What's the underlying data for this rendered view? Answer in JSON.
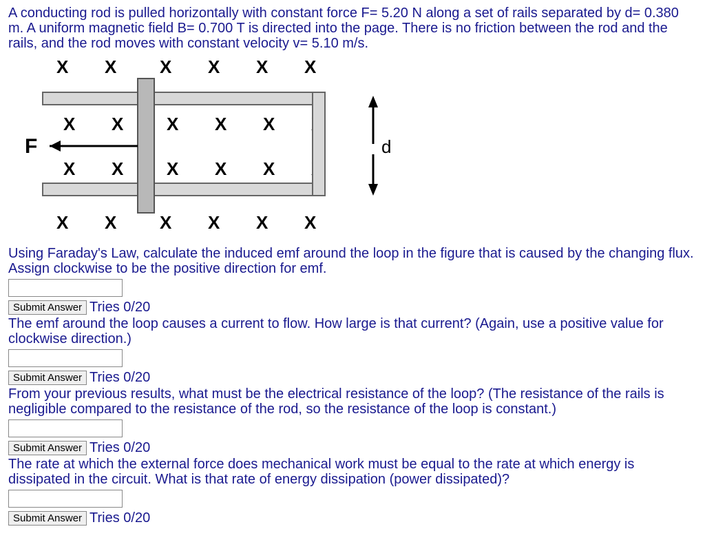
{
  "problem_intro": "A conducting rod is pulled horizontally with constant force F= 5.20 N along a set of rails separated by d= 0.380 m. A uniform magnetic field B= 0.700 T is directed into the page. There is no friction between the rod and the rails, and the rod moves with constant velocity v= 5.10 m/s.",
  "diagram": {
    "F_label": "F",
    "d_label": "d"
  },
  "questions": [
    {
      "text": "Using Faraday's Law, calculate the induced emf around the loop in the figure that is caused by the changing flux. Assign clockwise to be the positive direction for emf.",
      "submit_label": "Submit Answer",
      "tries": "Tries 0/20"
    },
    {
      "text": "The emf around the loop causes a current to flow. How large is that current? (Again, use a positive value for clockwise direction.)",
      "submit_label": "Submit Answer",
      "tries": "Tries 0/20"
    },
    {
      "text": "From your previous results, what must be the electrical resistance of the loop? (The resistance of the rails is negligible compared to the resistance of the rod, so the resistance of the loop is constant.)",
      "submit_label": "Submit Answer",
      "tries": "Tries 0/20"
    },
    {
      "text": "The rate at which the external force does mechanical work must be equal to the rate at which energy is dissipated in the circuit. What is that rate of energy dissipation (power dissipated)?",
      "submit_label": "Submit Answer",
      "tries": "Tries 0/20"
    }
  ]
}
